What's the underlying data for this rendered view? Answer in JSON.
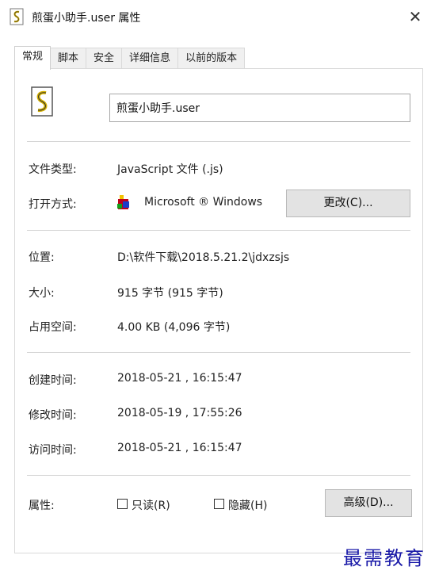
{
  "window": {
    "title": "煎蛋小助手.user 属性",
    "close_label": "✕"
  },
  "tabs": [
    {
      "label": "常规",
      "active": true
    },
    {
      "label": "脚本",
      "active": false
    },
    {
      "label": "安全",
      "active": false
    },
    {
      "label": "详细信息",
      "active": false
    },
    {
      "label": "以前的版本",
      "active": false
    }
  ],
  "general": {
    "file_name": "煎蛋小助手.user",
    "file_type_label": "文件类型:",
    "file_type_value": "JavaScript 文件 (.js)",
    "open_with_label": "打开方式:",
    "open_with_value": "Microsoft ® Windows",
    "change_button": "更改(C)...",
    "location_label": "位置:",
    "location_value": "D:\\软件下载\\2018.5.21.2\\jdxzsjs",
    "size_label": "大小:",
    "size_value": "915 字节 (915 字节)",
    "disk_size_label": "占用空间:",
    "disk_size_value": "4.00 KB (4,096 字节)",
    "created_label": "创建时间:",
    "created_value": "2018-05-21 , 16:15:47",
    "modified_label": "修改时间:",
    "modified_value": "2018-05-19 , 17:55:26",
    "accessed_label": "访问时间:",
    "accessed_value": "2018-05-21 , 16:15:47",
    "attributes_label": "属性:",
    "readonly_label": "只读(R)",
    "readonly_checked": false,
    "hidden_label": "隐藏(H)",
    "hidden_checked": false,
    "advanced_button": "高级(D)..."
  },
  "watermark": "最需教育",
  "icons": {
    "title": "script-file-icon",
    "file": "script-file-icon",
    "app": "windows-script-host-icon",
    "close": "close-icon"
  }
}
